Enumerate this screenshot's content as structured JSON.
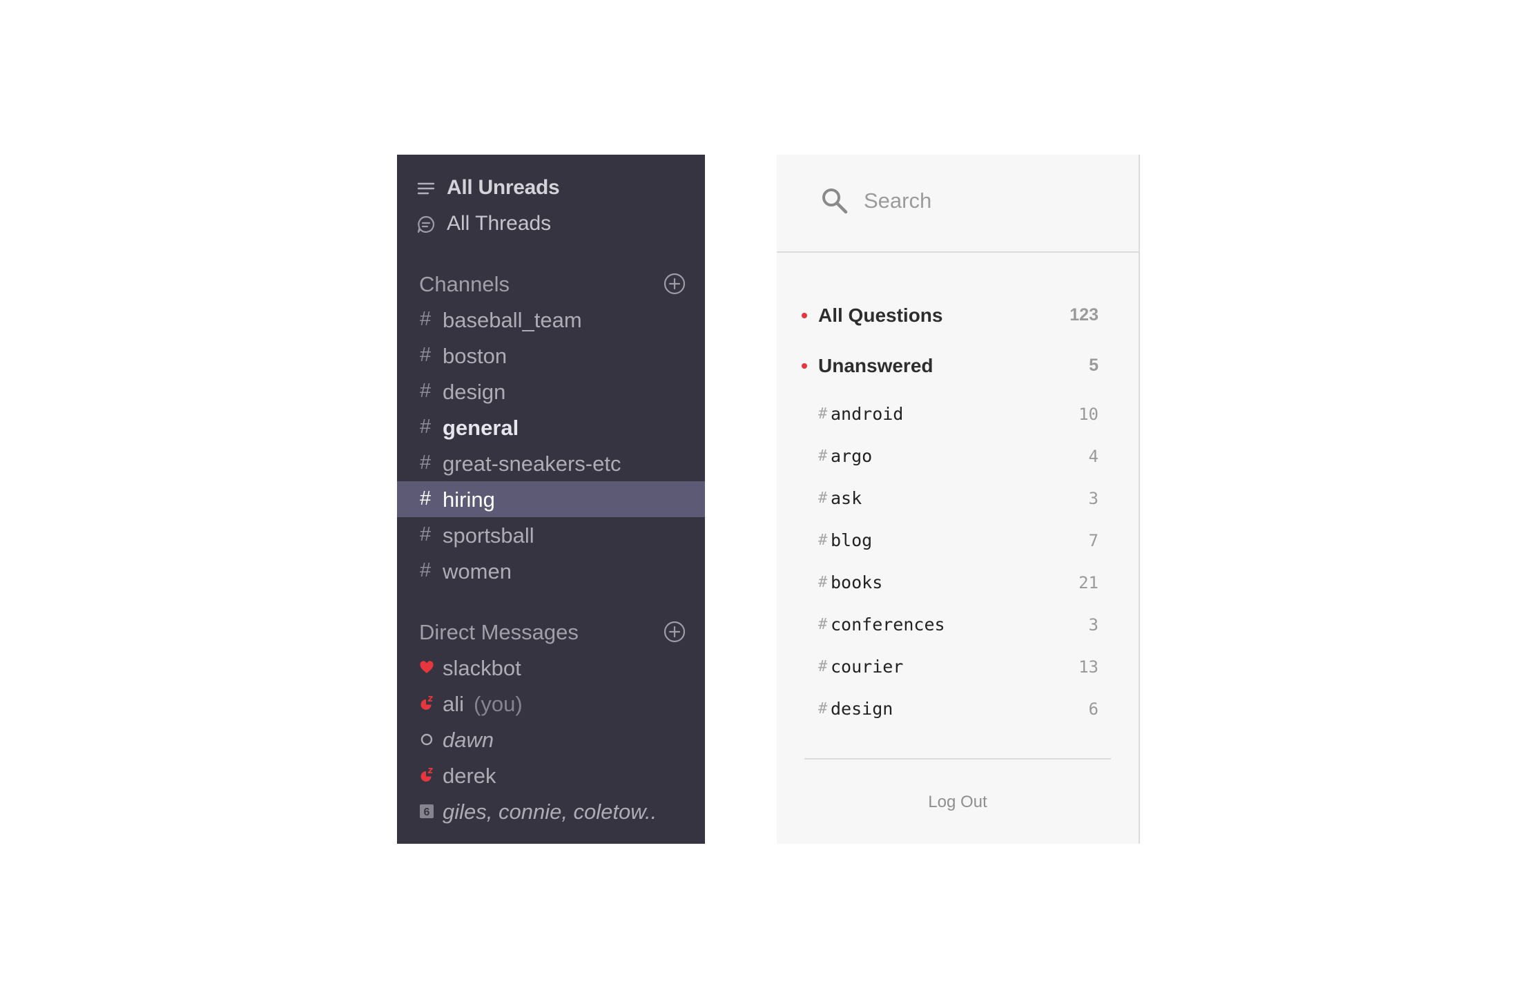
{
  "sidebar": {
    "top_items": [
      {
        "label": "All Unreads",
        "icon": "list-icon"
      },
      {
        "label": "All Threads",
        "icon": "thread-icon"
      }
    ],
    "channels_header": "Channels",
    "channels": [
      {
        "label": "baseball_team",
        "state": "normal"
      },
      {
        "label": "boston",
        "state": "normal"
      },
      {
        "label": "design",
        "state": "normal"
      },
      {
        "label": "general",
        "state": "unread"
      },
      {
        "label": "great-sneakers-etc",
        "state": "normal"
      },
      {
        "label": "hiring",
        "state": "active"
      },
      {
        "label": "sportsball",
        "state": "normal"
      },
      {
        "label": "women",
        "state": "normal"
      }
    ],
    "dm_header": "Direct Messages",
    "direct_messages": [
      {
        "label": "slackbot",
        "status": "heart-icon"
      },
      {
        "label": "ali",
        "suffix": "(you)",
        "status": "snooze-icon"
      },
      {
        "label": "dawn",
        "status": "away-icon"
      },
      {
        "label": "derek",
        "status": "snooze-icon"
      },
      {
        "label": "giles, connie, coletow..",
        "status": "group-count-icon",
        "group_count": "6"
      }
    ],
    "colors": {
      "background": "#363440",
      "active_row": "#5d5a76",
      "status_red": "#e8363f"
    }
  },
  "panel": {
    "search": {
      "placeholder": "Search",
      "value": ""
    },
    "filters": [
      {
        "label": "All Questions",
        "count": "123"
      },
      {
        "label": "Unanswered",
        "count": "5"
      }
    ],
    "tags": [
      {
        "label": "android",
        "count": "10"
      },
      {
        "label": "argo",
        "count": "4"
      },
      {
        "label": "ask",
        "count": "3"
      },
      {
        "label": "blog",
        "count": "7"
      },
      {
        "label": "books",
        "count": "21"
      },
      {
        "label": "conferences",
        "count": "3"
      },
      {
        "label": "courier",
        "count": "13"
      },
      {
        "label": "design",
        "count": "6"
      }
    ],
    "hash_symbol": "#",
    "logout_label": "Log Out",
    "colors": {
      "background": "#f7f7f7",
      "accent_dot": "#e8363f"
    }
  }
}
